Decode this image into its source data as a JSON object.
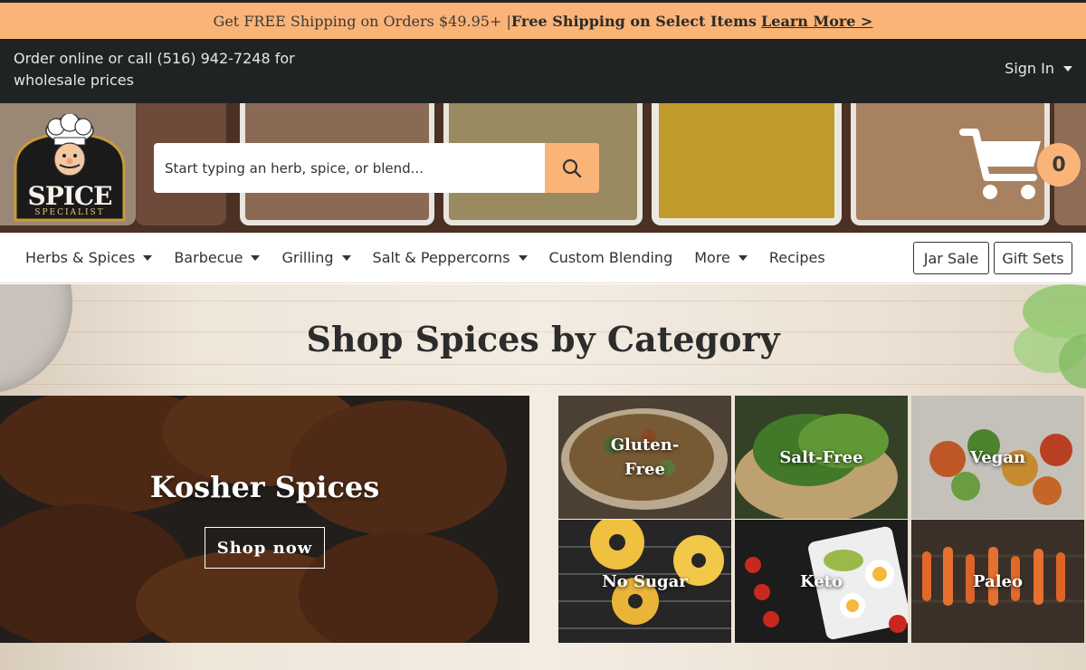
{
  "promo": {
    "text": "Get FREE Shipping on Orders $49.95+ | ",
    "bold": "Free Shipping on Select Items",
    "link": "Learn More >"
  },
  "infobar": {
    "call_line1": "Order online or call (516) 942-7248 for",
    "call_line2": "wholesale prices",
    "signin": "Sign In"
  },
  "header": {
    "logo_text": "SPICE",
    "logo_sub": "SPECIALIST",
    "search_placeholder": "Start typing an herb, spice, or blend...",
    "cart_count": "0"
  },
  "nav": {
    "items": [
      {
        "label": "Herbs & Spices",
        "dropdown": true
      },
      {
        "label": "Barbecue",
        "dropdown": true
      },
      {
        "label": "Grilling",
        "dropdown": true
      },
      {
        "label": "Salt & Peppercorns",
        "dropdown": true
      },
      {
        "label": "Custom Blending",
        "dropdown": false
      },
      {
        "label": "More",
        "dropdown": true
      },
      {
        "label": "Recipes",
        "dropdown": false
      }
    ],
    "jar_sale": "Jar Sale",
    "gift_sets": "Gift Sets"
  },
  "section": {
    "title": "Shop Spices by Category",
    "feature": {
      "title": "Kosher Spices",
      "button": "Shop now"
    },
    "tiles": [
      {
        "label_line1": "Gluten-",
        "label_line2": "Free"
      },
      {
        "label_line1": "Salt-Free",
        "label_line2": ""
      },
      {
        "label_line1": "Vegan",
        "label_line2": ""
      },
      {
        "label_line1": "No Sugar",
        "label_line2": ""
      },
      {
        "label_line1": "Keto",
        "label_line2": ""
      },
      {
        "label_line1": "Paleo",
        "label_line2": ""
      }
    ]
  },
  "colors": {
    "accent": "#fbb478",
    "dark": "#1f2324"
  }
}
